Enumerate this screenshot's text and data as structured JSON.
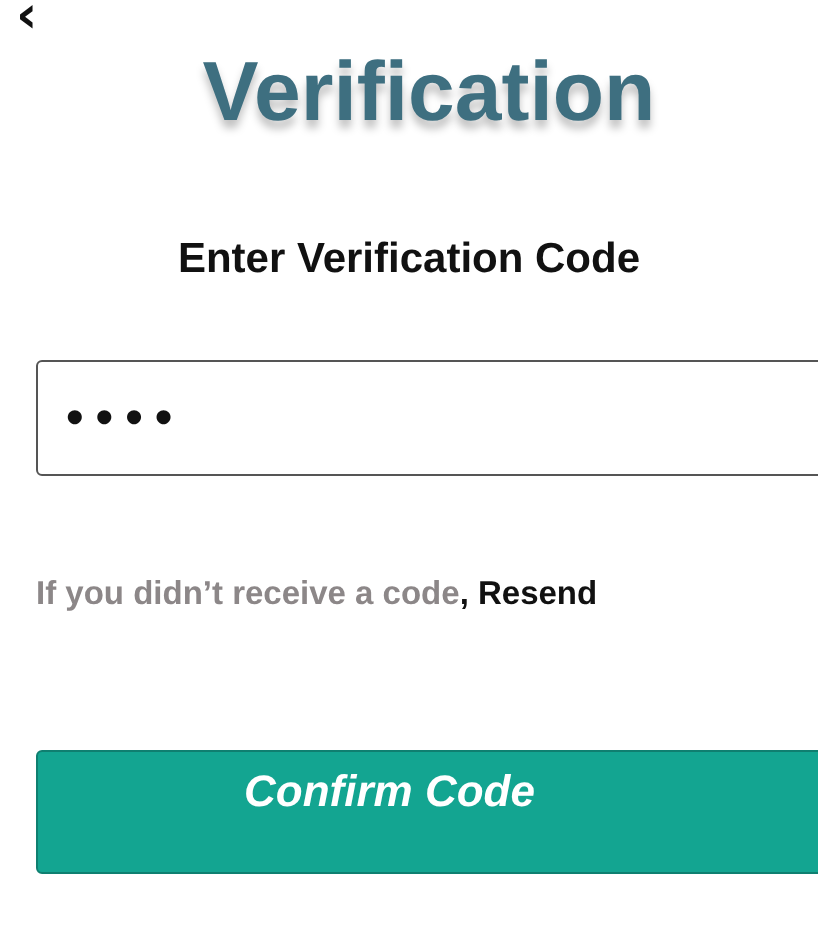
{
  "back_button": {
    "label": "‹"
  },
  "title": "Verification",
  "heading": "Enter Verification Code",
  "code_field": {
    "value": "••••"
  },
  "resend": {
    "prompt": "If you didn’t receive a code",
    "link": ", Resend"
  },
  "confirm_button": {
    "label": "Confirm Code"
  }
}
